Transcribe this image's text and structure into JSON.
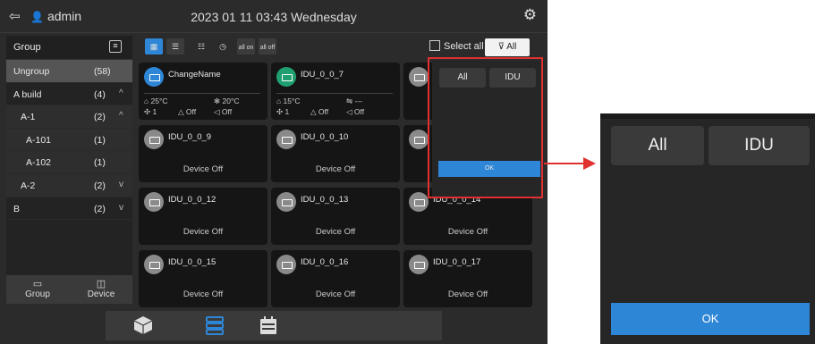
{
  "header": {
    "user": "admin",
    "datetime": "2023 01 11 03:43 Wednesday"
  },
  "sidebar": {
    "title": "Group",
    "items": [
      {
        "name": "Ungroup",
        "count": "(58)",
        "arrow": ""
      },
      {
        "name": "A build",
        "count": "(4)",
        "arrow": "^"
      },
      {
        "name": "A-1",
        "count": "(2)",
        "arrow": "^"
      },
      {
        "name": "A-101",
        "count": "(1)",
        "arrow": ""
      },
      {
        "name": "A-102",
        "count": "(1)",
        "arrow": ""
      },
      {
        "name": "A-2",
        "count": "(2)",
        "arrow": "v"
      },
      {
        "name": "B",
        "count": "(2)",
        "arrow": "v"
      }
    ],
    "footer": {
      "group": "Group",
      "device": "Device"
    }
  },
  "toolbar": {
    "all_on": "all on",
    "all_off": "all off",
    "select_all": "Select all",
    "filter": "All"
  },
  "cards": [
    {
      "name": "ChangeName",
      "temp": "25°C",
      "set": "20°C",
      "count": "1",
      "s1": "Off",
      "s2": "Off"
    },
    {
      "name": "IDU_0_0_7",
      "temp": "15°C",
      "set": "---",
      "count": "1",
      "s1": "Off",
      "s2": "Off"
    },
    {
      "name": "IDU_0_0_9",
      "status": "Device Off"
    },
    {
      "name": "IDU_0_0_10",
      "status": "Device Off"
    },
    {
      "name": "IDU_0_0_12",
      "status": "Device Off"
    },
    {
      "name": "IDU_0_0_13",
      "status": "Device Off"
    },
    {
      "name": "IDU_0_0_14",
      "status": "Device Off"
    },
    {
      "name": "IDU_0_0_15",
      "status": "Device Off"
    },
    {
      "name": "IDU_0_0_16",
      "status": "Device Off"
    },
    {
      "name": "IDU_0_0_17",
      "status": "Device Off"
    }
  ],
  "popup": {
    "all": "All",
    "idu": "IDU",
    "ok": "OK"
  },
  "colors": {
    "accent": "#2e86d6",
    "highlight": "#e03030",
    "background": "#2b2b2b"
  }
}
